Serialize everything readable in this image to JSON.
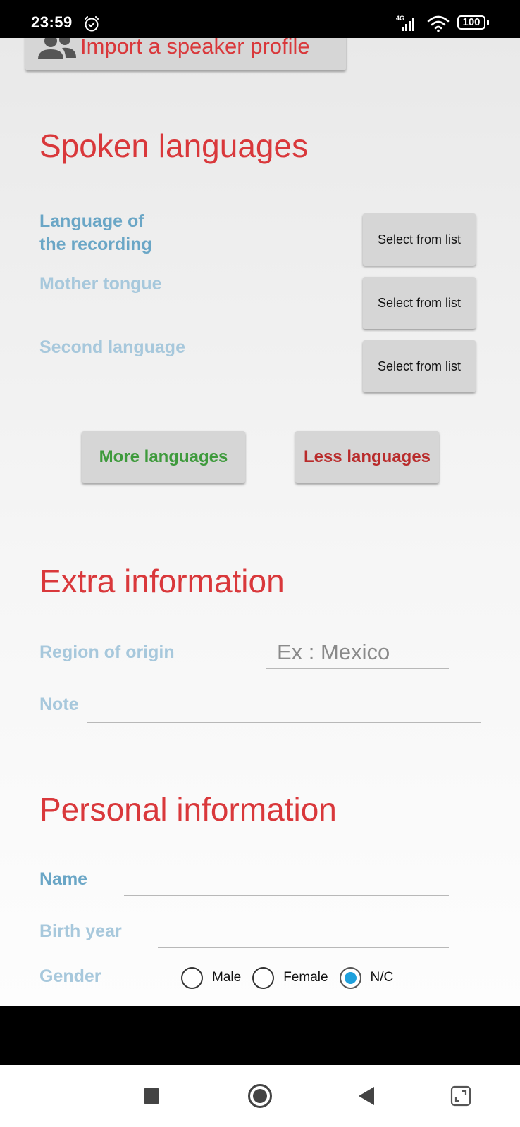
{
  "status_bar": {
    "time": "23:59",
    "network": "4G",
    "battery": "100"
  },
  "import_button": {
    "label": "Import a speaker profile",
    "icon": "users-icon"
  },
  "spoken_languages": {
    "title": "Spoken languages",
    "rows": [
      {
        "label_line1": "Language of",
        "label_line2": "the recording",
        "button": "Select from list"
      },
      {
        "label": "Mother tongue",
        "button": "Select from list"
      },
      {
        "label": "Second language",
        "button": "Select from list"
      }
    ],
    "more_label": "More languages",
    "less_label": "Less languages"
  },
  "extra_information": {
    "title": "Extra information",
    "region_label": "Region of origin",
    "region_placeholder": "Ex : Mexico",
    "note_label": "Note"
  },
  "personal_information": {
    "title": "Personal information",
    "name_label": "Name",
    "birth_label": "Birth year",
    "gender_label": "Gender",
    "gender_options": [
      "Male",
      "Female",
      "N/C"
    ],
    "gender_selected": "N/C"
  },
  "colors": {
    "title_red": "#d9383b",
    "label_blue": "#a7c8dc",
    "label_blue_active": "#6aa6c6",
    "more_green": "#3e9a3c",
    "less_red": "#b92b2b",
    "radio_selected": "#1ea0dc"
  },
  "nav_bar": {
    "icons": [
      "recents-square-icon",
      "home-circle-icon",
      "back-triangle-icon",
      "screenshot-corner-icon"
    ]
  }
}
